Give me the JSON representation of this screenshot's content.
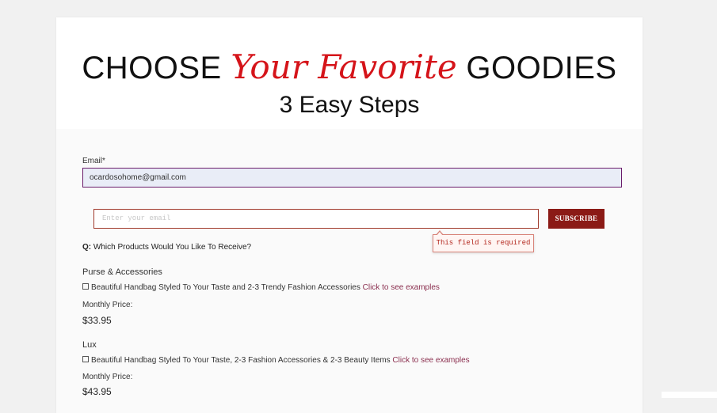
{
  "banner": {
    "headline_before": "CHOOSE ",
    "headline_script": "Your Favorite",
    "headline_after": " GOODIES",
    "subheadline": "3 Easy Steps"
  },
  "form": {
    "email_label": "Email*",
    "email_value": "ocardosohome@gmail.com"
  },
  "subscribe": {
    "placeholder": "Enter your email",
    "button_label": "SUBSCRIBE",
    "error_message": "This field is required"
  },
  "question": {
    "prefix": "Q:",
    "text": " Which Products Would You Like To Receive?"
  },
  "categories": [
    {
      "title": "Purse & Accessories",
      "option_text": "Beautiful Handbag Styled To Your Taste and 2-3 Trendy Fashion Accessories",
      "link_text": "Click to see examples",
      "price_label": "Monthly Price:",
      "price": "$33.95"
    },
    {
      "title": "Lux",
      "option_text": "Beautiful Handbag Styled To Your Taste, 2-3 Fashion Accessories & 2-3 Beauty Items",
      "link_text": "Click to see examples",
      "price_label": "Monthly Price:",
      "price": "$43.95"
    }
  ],
  "colors": {
    "accent_red": "#d5141a",
    "button_bg": "#8b1a16",
    "link": "#8a2e4e",
    "email_border": "#6a1b6a"
  }
}
